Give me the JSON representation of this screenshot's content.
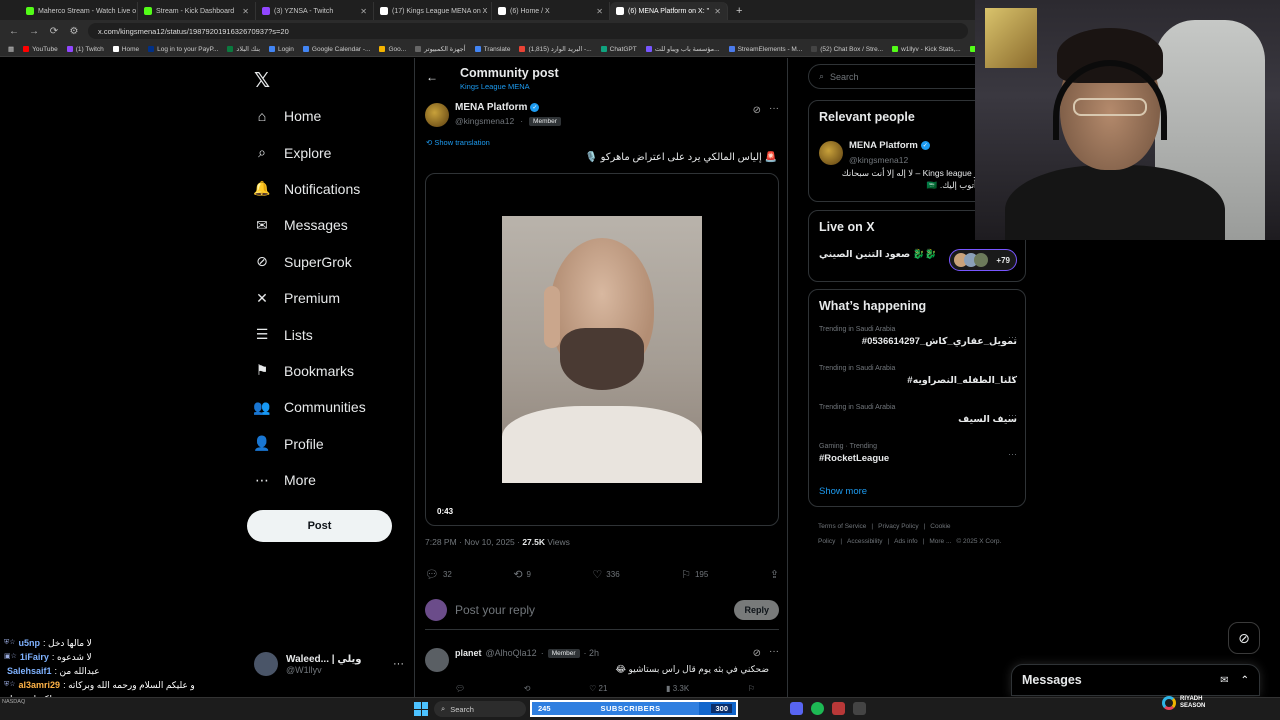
{
  "browser": {
    "tabs": [
      {
        "label": "Maherco Stream - Watch Live o",
        "color": "#53fc18"
      },
      {
        "label": "Stream - Kick Dashboard",
        "color": "#53fc18"
      },
      {
        "label": "(3) YZNSA - Twitch",
        "color": "#9146ff"
      },
      {
        "label": "(17) Kings League MENA on X",
        "color": "#ffffff"
      },
      {
        "label": "(6) Home / X",
        "color": "#ffffff"
      },
      {
        "label": "(6) MENA Platform on X: \"",
        "color": "#ffffff"
      }
    ],
    "url": "x.com/kingsmena12/status/1987920191632670937?s=20",
    "bookmarks": [
      "YouTube",
      "(1) Twitch",
      "Home",
      "Log in to your PayP...",
      "بنك البلاد",
      "Login",
      "Google Calendar -...",
      "Goo...",
      "أجهزة الكمبيوتر",
      "Translate",
      "(1,815) البريد الوارد -...",
      "ChatGPT",
      "مؤسسة باب ويباو للت...",
      "StreamElements - M...",
      "(52) Chat Box / Stre...",
      "w1llyv - Kick Stats,...",
      "Kick",
      "b"
    ]
  },
  "nav": {
    "items": [
      {
        "label": "Home",
        "icon": "⌂"
      },
      {
        "label": "Explore",
        "icon": "⌕"
      },
      {
        "label": "Notifications",
        "icon": "🔔"
      },
      {
        "label": "Messages",
        "icon": "✉"
      },
      {
        "label": "SuperGrok",
        "icon": "⊘"
      },
      {
        "label": "Premium",
        "icon": "✕"
      },
      {
        "label": "Lists",
        "icon": "☰"
      },
      {
        "label": "Bookmarks",
        "icon": "⚑"
      },
      {
        "label": "Communities",
        "icon": "👥"
      },
      {
        "label": "Profile",
        "icon": "👤"
      },
      {
        "label": "More",
        "icon": "⋯"
      }
    ],
    "post_label": "Post",
    "profile": {
      "name": "Waleed... | ويلي",
      "handle": "@W1llyv"
    }
  },
  "post": {
    "header_title": "Community post",
    "header_sub": "Kings League MENA",
    "author_name": "MENA Platform",
    "author_handle": "@kingsmena12",
    "member_badge": "Member",
    "show_translation": "Show translation",
    "text": "🚨 إلياس المالكي يرد على اعتراض ماهركو 🎙️",
    "video_duration": "0:43",
    "time": "7:28 PM · Nov 10, 2025 · ",
    "views_count": "27.5K",
    "views_label": " Views",
    "replies": "32",
    "reposts": "9",
    "likes": "336",
    "bookmarks": "195",
    "reply_placeholder": "Post your reply",
    "reply_button": "Reply"
  },
  "reply": {
    "name": "planet",
    "handle": "@AlhoQla12",
    "badge": "Member",
    "age": "· 2h",
    "text": "ضحكني في بثه يوم قال راس بستاشيو 😂",
    "likes": "21",
    "views": "3.3K"
  },
  "right": {
    "search_placeholder": "Search",
    "relevant_title": "Relevant people",
    "relevant_name": "MENA Platform",
    "relevant_handle": "@kingsmena12",
    "relevant_bio": "منصة بأخبار Kings league – لا إله إلا أنت سبحانك استغفرك وأتوب إليك. 🇸🇦",
    "live_title": "Live on X",
    "live_text": "صعود التنين الصيني 🐉🐉",
    "live_count": "+79",
    "happening_title": "What’s happening",
    "trends": [
      {
        "meta": "Trending in Saudi Arabia",
        "name": "#تمويل_عقاري_كاش_0536614297"
      },
      {
        "meta": "Trending in Saudi Arabia",
        "name": "#كلنا_الطفله_النصراويه"
      },
      {
        "meta": "Trending in Saudi Arabia",
        "name": "سيف السيف"
      },
      {
        "meta": "Gaming · Trending",
        "name": "#RocketLeague"
      }
    ],
    "show_more": "Show more",
    "footer": [
      "Terms of Service",
      "|",
      "Privacy Policy",
      "|",
      "Cookie Policy",
      "|",
      "Accessibility",
      "|",
      "Ads info",
      "|",
      "More ...",
      "© 2025 X Corp."
    ]
  },
  "chat": [
    {
      "user": "u5np",
      "msg": ": لا مالها دخل",
      "badges": "⛨☆"
    },
    {
      "user": "1iFairy",
      "msg": ": لا شدعوه",
      "badges": "▣☆"
    },
    {
      "user": "Salehsaif1",
      "msg": ": عبدالله من",
      "badges": ""
    },
    {
      "user": "al3amri29",
      "msg": ": و عليكم السلام ورحمه الله وبركاته",
      "badges": "⛨☆"
    },
    {
      "user": "",
      "msg": "ولكسلم نبيها",
      "badges": ""
    }
  ],
  "messages_dock": "Messages",
  "taskbar": {
    "search": "Search",
    "subs_current": "245",
    "subs_label": "SUBSCRIBERS",
    "subs_goal": "300",
    "subs_progress": 0.82,
    "riyadh_line1": "RIYADH",
    "riyadh_line2": "SEASON",
    "nasdaq": "NASDAQ"
  },
  "colors": {
    "accent": "#1d9bf0",
    "background": "#000000",
    "text": "#e7e9ea",
    "muted": "#71767b"
  }
}
